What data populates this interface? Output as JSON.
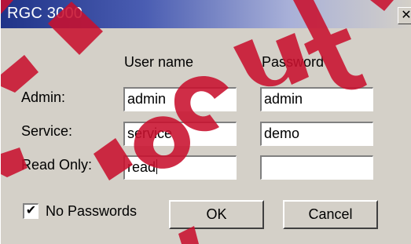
{
  "window": {
    "title": "RGC 3000",
    "close_glyph": "✕"
  },
  "columns": {
    "user_name": "User name",
    "password": "Password"
  },
  "rows": [
    {
      "label": "Admin:",
      "user": "admin",
      "password": "admin"
    },
    {
      "label": "Service:",
      "user": "service",
      "password": "demo"
    },
    {
      "label": "Read Only:",
      "user": "read",
      "password": ""
    }
  ],
  "options": {
    "no_passwords_label": "No Passwords",
    "no_passwords_checked": true,
    "check_glyph": "✔"
  },
  "buttons": {
    "ok": "OK",
    "cancel": "Cancel"
  },
  "colors": {
    "title_bar": "#203488",
    "dialog_bg": "#d4d0c8",
    "watermark": "#c8102e"
  }
}
